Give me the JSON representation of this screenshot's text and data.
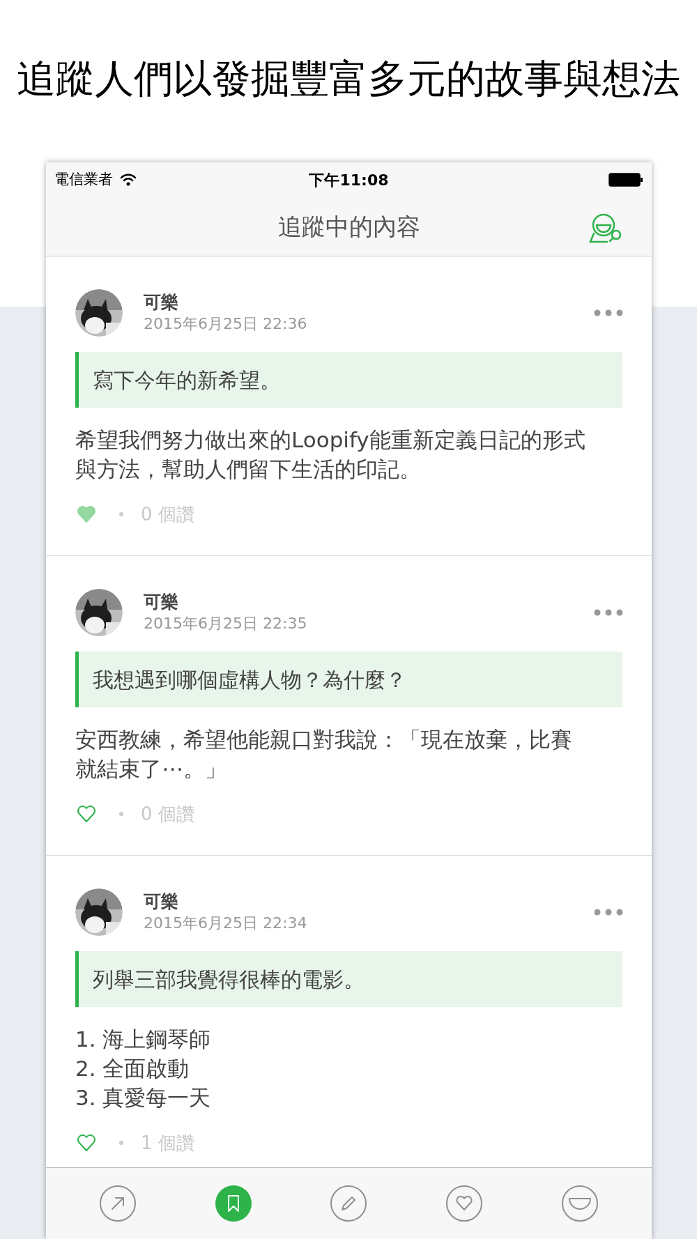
{
  "headline": "追蹤人們以發掘豐富多元的故事與想法",
  "status_bar": {
    "carrier": "電信業者",
    "time": "下午11:08"
  },
  "nav_bar": {
    "title": "追蹤中的內容"
  },
  "posts": [
    {
      "author": "可樂",
      "date": "2015年6月25日 22:36",
      "prompt": "寫下今年的新希望。",
      "body_lines": [
        "希望我們努力做出來的Loopify能重新定義日記的形式",
        "與方法，幫助人們留下生活的印記。"
      ],
      "liked": true,
      "likes": "0 個讚"
    },
    {
      "author": "可樂",
      "date": "2015年6月25日 22:35",
      "prompt": "我想遇到哪個虛構人物？為什麼？",
      "body_lines": [
        "安西教練，希望他能親口對我說：「現在放棄，比賽",
        "就結束了⋯。」"
      ],
      "liked": false,
      "likes": "0 個讚"
    },
    {
      "author": "可樂",
      "date": "2015年6月25日 22:34",
      "prompt": "列舉三部我覺得很棒的電影。",
      "body_lines": [
        "1. 海上鋼琴師",
        "2. 全面啟動",
        "3. 真愛每一天"
      ],
      "liked": false,
      "likes": "1 個讚"
    }
  ],
  "tab_bar": [
    {
      "kind": "share",
      "selected": false
    },
    {
      "kind": "bookmark",
      "selected": true
    },
    {
      "kind": "write",
      "selected": false
    },
    {
      "kind": "heart",
      "selected": false
    },
    {
      "kind": "smile",
      "selected": false
    }
  ]
}
